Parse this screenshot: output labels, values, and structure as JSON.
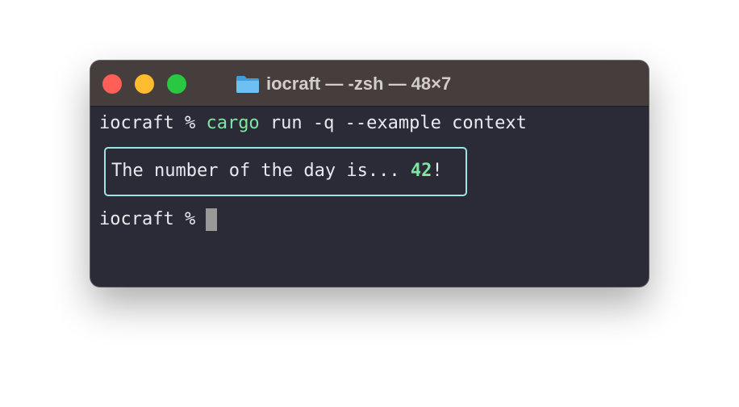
{
  "window": {
    "title": "iocraft — -zsh — 48×7",
    "folder_icon": "folder-icon"
  },
  "terminal": {
    "prompt": "iocraft % ",
    "command_name": "cargo",
    "command_args": " run -q --example context",
    "output_text": "The number of the day is... ",
    "output_number": "42",
    "output_suffix": "!",
    "prompt2": "iocraft % "
  },
  "colors": {
    "background": "#2a2b36",
    "titlebar": "#463e3d",
    "accent_green": "#7ee6a2",
    "box_border": "#9be4e8",
    "text": "#e9e9ef"
  }
}
